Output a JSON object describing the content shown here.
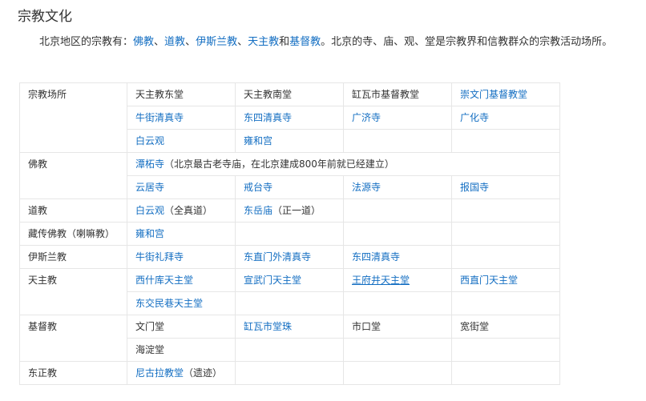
{
  "section_title": "宗教文化",
  "intro": {
    "before": "北京地区的宗教有：",
    "religions": [
      "佛教",
      "道教",
      "伊斯兰教",
      "天主教",
      "基督教"
    ],
    "sep": "、",
    "and": "和",
    "after": "。北京的寺、庙、观、堂是宗教界和信教群众的宗教活动场所。"
  },
  "table": {
    "groups": [
      {
        "category": "宗教场所",
        "rows": [
          [
            {
              "text": "天主教东堂",
              "link": false
            },
            {
              "text": "天主教南堂",
              "link": false
            },
            {
              "text": "缸瓦市基督教堂",
              "link": false
            },
            {
              "text": "崇文门基督教堂",
              "link": true
            }
          ],
          [
            {
              "text": "牛街清真寺",
              "link": true
            },
            {
              "text": "东四清真寺",
              "link": true
            },
            {
              "text": "广济寺",
              "link": true
            },
            {
              "text": "广化寺",
              "link": true
            }
          ],
          [
            {
              "text": "白云观",
              "link": true
            },
            {
              "text": "雍和宫",
              "link": true
            },
            {
              "text": "",
              "link": false
            },
            {
              "text": "",
              "link": false
            }
          ]
        ]
      },
      {
        "category": "佛教",
        "rows": [
          [
            {
              "text": "潭柘寺",
              "link": true,
              "note": "（北京最古老寺庙，在北京建成800年前就已经建立）",
              "span": 4
            }
          ],
          [
            {
              "text": "云居寺",
              "link": true
            },
            {
              "text": "戒台寺",
              "link": true
            },
            {
              "text": "法源寺",
              "link": true
            },
            {
              "text": "报国寺",
              "link": true
            }
          ]
        ]
      },
      {
        "category": "道教",
        "rows": [
          [
            {
              "text": "白云观",
              "link": true,
              "note": "（全真道）"
            },
            {
              "text": "东岳庙",
              "link": true,
              "note": "（正一道）"
            },
            {
              "text": "",
              "link": false
            },
            {
              "text": "",
              "link": false
            }
          ]
        ]
      },
      {
        "category": "藏传佛教（喇嘛教）",
        "rows": [
          [
            {
              "text": "雍和宫",
              "link": true
            },
            {
              "text": "",
              "link": false
            },
            {
              "text": "",
              "link": false
            },
            {
              "text": "",
              "link": false
            }
          ]
        ]
      },
      {
        "category": "伊斯兰教",
        "rows": [
          [
            {
              "text": "牛街礼拜寺",
              "link": true
            },
            {
              "text": "东直门外清真寺",
              "link": true
            },
            {
              "text": "东四清真寺",
              "link": true
            },
            {
              "text": "",
              "link": false
            }
          ]
        ]
      },
      {
        "category": "天主教",
        "rows": [
          [
            {
              "text": "西什库天主堂",
              "link": true
            },
            {
              "text": "宣武门天主堂",
              "link": true
            },
            {
              "text": "王府井天主堂",
              "link": true,
              "underline": true
            },
            {
              "text": "西直门天主堂",
              "link": true
            }
          ],
          [
            {
              "text": "东交民巷天主堂",
              "link": true
            },
            {
              "text": "",
              "link": false
            },
            {
              "text": "",
              "link": false
            },
            {
              "text": "",
              "link": false
            }
          ]
        ]
      },
      {
        "category": "基督教",
        "rows": [
          [
            {
              "text": "文门堂",
              "link": false
            },
            {
              "text": "缸瓦市堂珠",
              "link": true
            },
            {
              "text": "市口堂",
              "link": false
            },
            {
              "text": "宽街堂",
              "link": false
            }
          ],
          [
            {
              "text": "海淀堂",
              "link": false
            },
            {
              "text": "",
              "link": false
            },
            {
              "text": "",
              "link": false
            },
            {
              "text": "",
              "link": false
            }
          ]
        ]
      },
      {
        "category": "东正教",
        "rows": [
          [
            {
              "text": "尼古拉教堂",
              "link": true,
              "note": "（遗迹）"
            },
            {
              "text": "",
              "link": false
            },
            {
              "text": "",
              "link": false
            },
            {
              "text": "",
              "link": false
            }
          ]
        ]
      }
    ]
  }
}
